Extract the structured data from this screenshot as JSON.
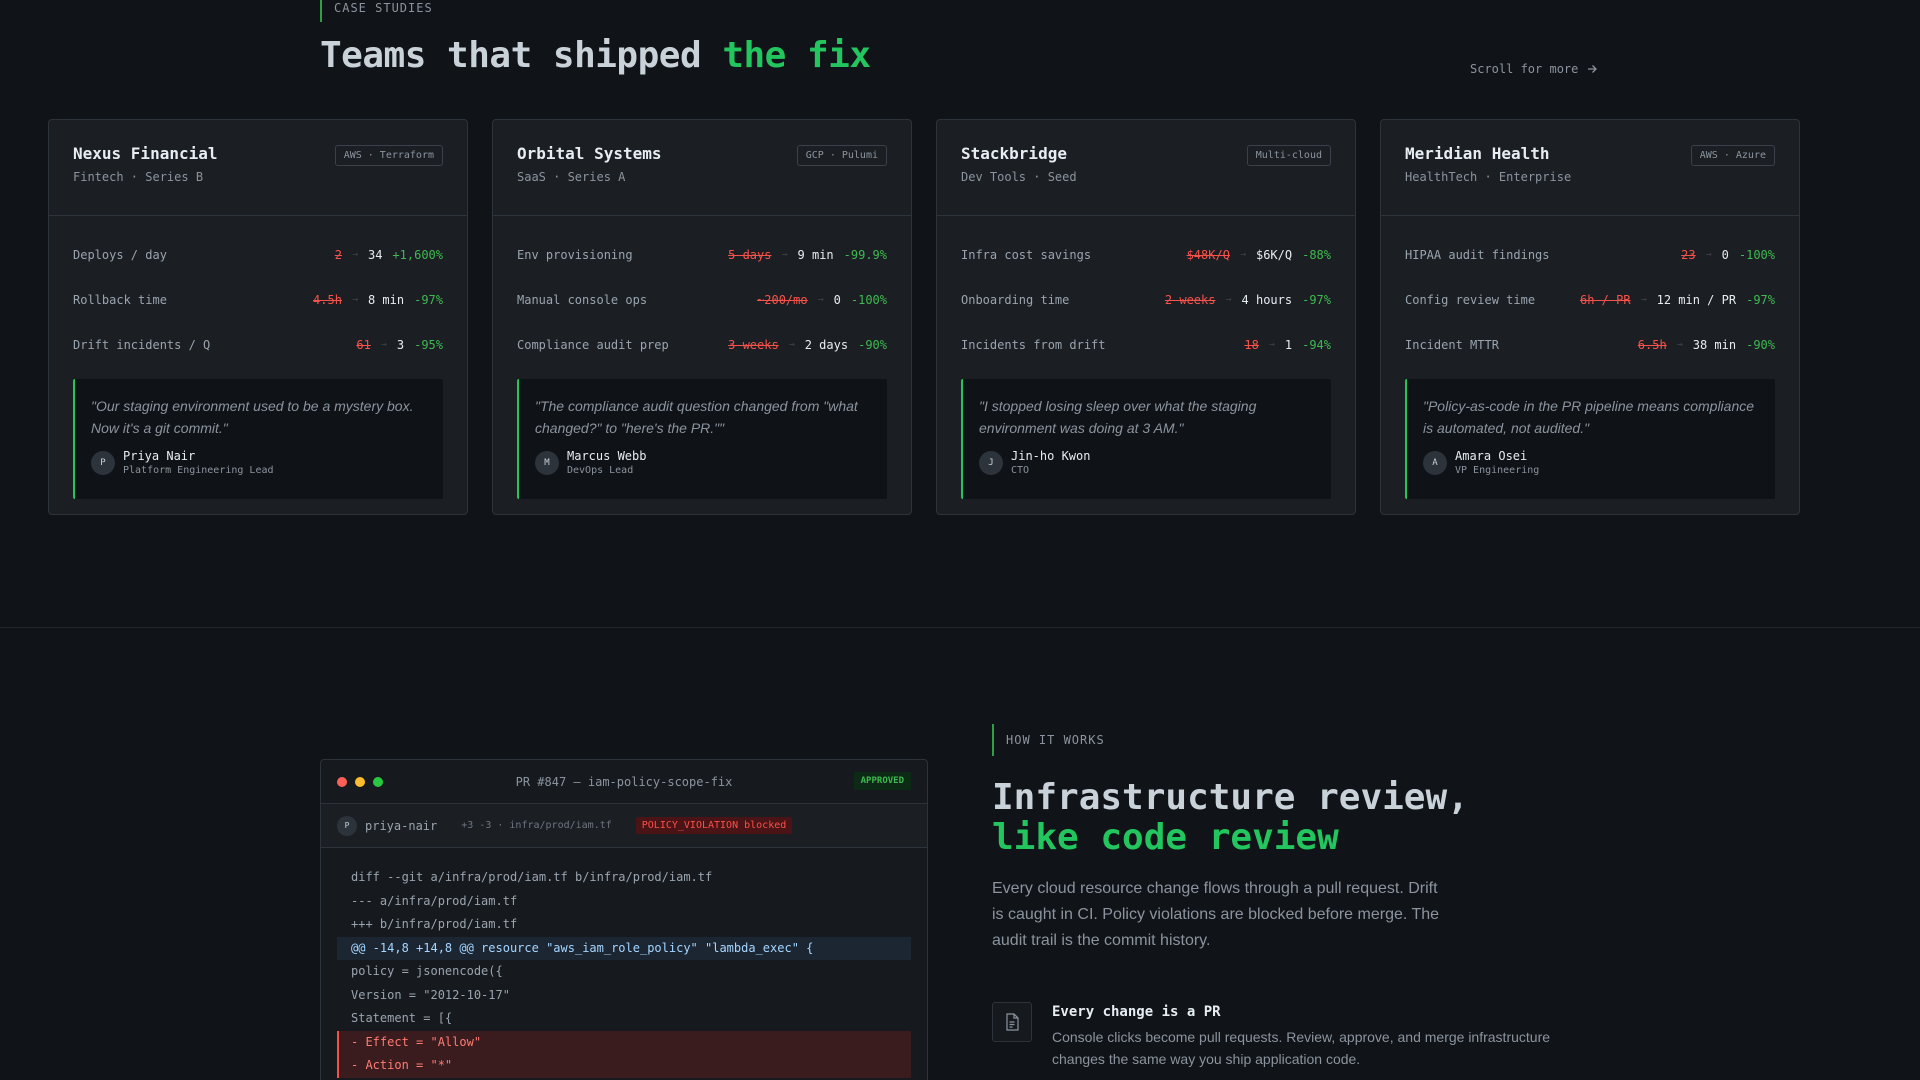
{
  "case_studies": {
    "eyebrow": "CASE STUDIES",
    "title_main": "Teams that shipped ",
    "title_accent": "the fix",
    "scroll_label": "Scroll for more",
    "cards": [
      {
        "name": "Nexus Financial",
        "subtitle": "Fintech · Series B",
        "tag": "AWS · Terraform",
        "metrics": [
          {
            "label": "Deploys / day",
            "before": "2",
            "after": "34",
            "delta": "+1,600%"
          },
          {
            "label": "Rollback time",
            "before": "4.5h",
            "after": "8 min",
            "delta": "-97%"
          },
          {
            "label": "Drift incidents / Q",
            "before": "61",
            "after": "3",
            "delta": "-95%"
          }
        ],
        "quote": "\"Our staging environment used to be a mystery box. Now it's a git commit.\"",
        "author_initial": "P",
        "author_name": "Priya Nair",
        "author_role": "Platform Engineering Lead"
      },
      {
        "name": "Orbital Systems",
        "subtitle": "SaaS · Series A",
        "tag": "GCP · Pulumi",
        "metrics": [
          {
            "label": "Env provisioning",
            "before": "5 days",
            "after": "9 min",
            "delta": "-99.9%"
          },
          {
            "label": "Manual console ops",
            "before": "~200/mo",
            "after": "0",
            "delta": "-100%"
          },
          {
            "label": "Compliance audit prep",
            "before": "3 weeks",
            "after": "2 days",
            "delta": "-90%"
          }
        ],
        "quote": "\"The compliance audit question changed from \"what changed?\" to \"here's the PR.\"\"",
        "author_initial": "M",
        "author_name": "Marcus Webb",
        "author_role": "DevOps Lead"
      },
      {
        "name": "Stackbridge",
        "subtitle": "Dev Tools · Seed",
        "tag": "Multi-cloud",
        "metrics": [
          {
            "label": "Infra cost savings",
            "before": "$48K/Q",
            "after": "$6K/Q",
            "delta": "-88%"
          },
          {
            "label": "Onboarding time",
            "before": "2 weeks",
            "after": "4 hours",
            "delta": "-97%"
          },
          {
            "label": "Incidents from drift",
            "before": "18",
            "after": "1",
            "delta": "-94%"
          }
        ],
        "quote": "\"I stopped losing sleep over what the staging environment was doing at 3 AM.\"",
        "author_initial": "J",
        "author_name": "Jin-ho Kwon",
        "author_role": "CTO"
      },
      {
        "name": "Meridian Health",
        "subtitle": "HealthTech · Enterprise",
        "tag": "AWS · Azure",
        "metrics": [
          {
            "label": "HIPAA audit findings",
            "before": "23",
            "after": "0",
            "delta": "-100%"
          },
          {
            "label": "Config review time",
            "before": "6h / PR",
            "after": "12 min / PR",
            "delta": "-97%"
          },
          {
            "label": "Incident MTTR",
            "before": "6.5h",
            "after": "38 min",
            "delta": "-90%"
          }
        ],
        "quote": "\"Policy-as-code in the PR pipeline means compliance is automated, not audited.\"",
        "author_initial": "A",
        "author_name": "Amara Osei",
        "author_role": "VP Engineering"
      }
    ]
  },
  "pr_window": {
    "title": "PR #847 — iam-policy-scope-fix",
    "status": "APPROVED",
    "user_initial": "P",
    "user": "priya-nair",
    "stats": "+3 -3 · infra/prod/iam.tf",
    "violation": "POLICY_VIOLATION blocked",
    "diff": [
      {
        "text": "diff --git a/infra/prod/iam.tf b/infra/prod/iam.tf",
        "kind": "context"
      },
      {
        "text": "--- a/infra/prod/iam.tf",
        "kind": "context"
      },
      {
        "text": "+++ b/infra/prod/iam.tf",
        "kind": "context"
      },
      {
        "text": "@@ -14,8 +14,8 @@ resource \"aws_iam_role_policy\" \"lambda_exec\" {",
        "kind": "hunk"
      },
      {
        "text": "policy = jsonencode({",
        "kind": "context"
      },
      {
        "text": "Version = \"2012-10-17\"",
        "kind": "context"
      },
      {
        "text": "Statement = [{",
        "kind": "context"
      },
      {
        "text": "- Effect = \"Allow\"",
        "kind": "removed"
      },
      {
        "text": "- Action = \"*\"",
        "kind": "removed"
      }
    ]
  },
  "how_it_works": {
    "eyebrow": "HOW IT WORKS",
    "title_line1": "Infrastructure review,",
    "title_line2": "like code review",
    "description": "Every cloud resource change flows through a pull request. Drift is caught in CI. Policy violations are blocked before merge. The audit trail is the commit history.",
    "feature": {
      "icon": "document-icon",
      "title": "Every change is a PR",
      "description": "Console clicks become pull requests. Review, approve, and merge infrastructure changes the same way you ship application code."
    }
  },
  "colors": {
    "accent": "#22c55e",
    "negative": "#f85149",
    "positive": "#3fb950",
    "background": "#101317",
    "card": "#1b1f24"
  }
}
